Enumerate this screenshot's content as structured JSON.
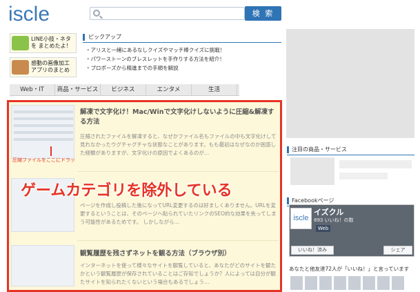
{
  "header": {
    "logo": "iscle",
    "search_placeholder": "",
    "search_button": "検 索"
  },
  "banners": [
    {
      "label": "LINE小技・ネタを まとめたよ！"
    },
    {
      "label": "感動の画像加工 アプリのまとめ"
    }
  ],
  "pickup": {
    "title": "ピックアップ",
    "items": [
      "・アリスと一緒にあるなしクイズやマッチ棒クイズに挑戦！",
      "・パワーストーンのブレスレットを手作りする方法を紹介！",
      "・プロポーズから精進までの手順を解説"
    ]
  },
  "tabs": [
    "Web・IT",
    "商品・サービス",
    "ビジネス",
    "エンタメ",
    "生活"
  ],
  "articles": [
    {
      "title": "解凍で文字化け！Mac/Winで文字化けしないように圧縮&解凍する方法",
      "body": "圧縮されたファイルを解凍すると、なぜかファイル名もファイルの中も文字化けして見れなかったウグチャグチャな状態なことがあります。もも最初はなぜなのか困惑した経験がありますが、文字化けの原因でよくあるのが…",
      "thumb_caption": "圧縮ファイルをここにドラッ"
    },
    {
      "title": "ゲームカテゴリを除外している",
      "body": "ページを作成し投稿した後になってURL変更するのは好ましくありません。URLを変更するということは、そのページへ貼られていたリンクのSEO的な効果を失ってしまう可能性があるためです。 しかしながら…"
    },
    {
      "title": "観覧履歴を残さずネットを観る方法（ブラウザ別）",
      "body": "インターネットを使って様々なサイトを観覧していると、あなたがどのサイトを観たかという観覧履歴が保存されていることはご存知でしょうか？人によっては自分が観たサイトを知られたくないという場合もあるでしょう…"
    }
  ],
  "overlay_text": "ゲームカテゴリを除外している",
  "sidebar": {
    "featured_title": "注目の商品・サービス",
    "facebook_title": "Facebookページ",
    "fb_page_name": "イズクル",
    "fb_likes": "893 いいね！の数",
    "fb_web": "Web",
    "fb_like_button": "いいね！済み",
    "fb_share_button": "シェア",
    "fb_friends": "あなたと他友達72人が「いいね！」と言っています"
  },
  "colors": {
    "accent": "#2f74b5",
    "highlight_border": "#e53325",
    "highlight_bg": "#fdf8da"
  }
}
